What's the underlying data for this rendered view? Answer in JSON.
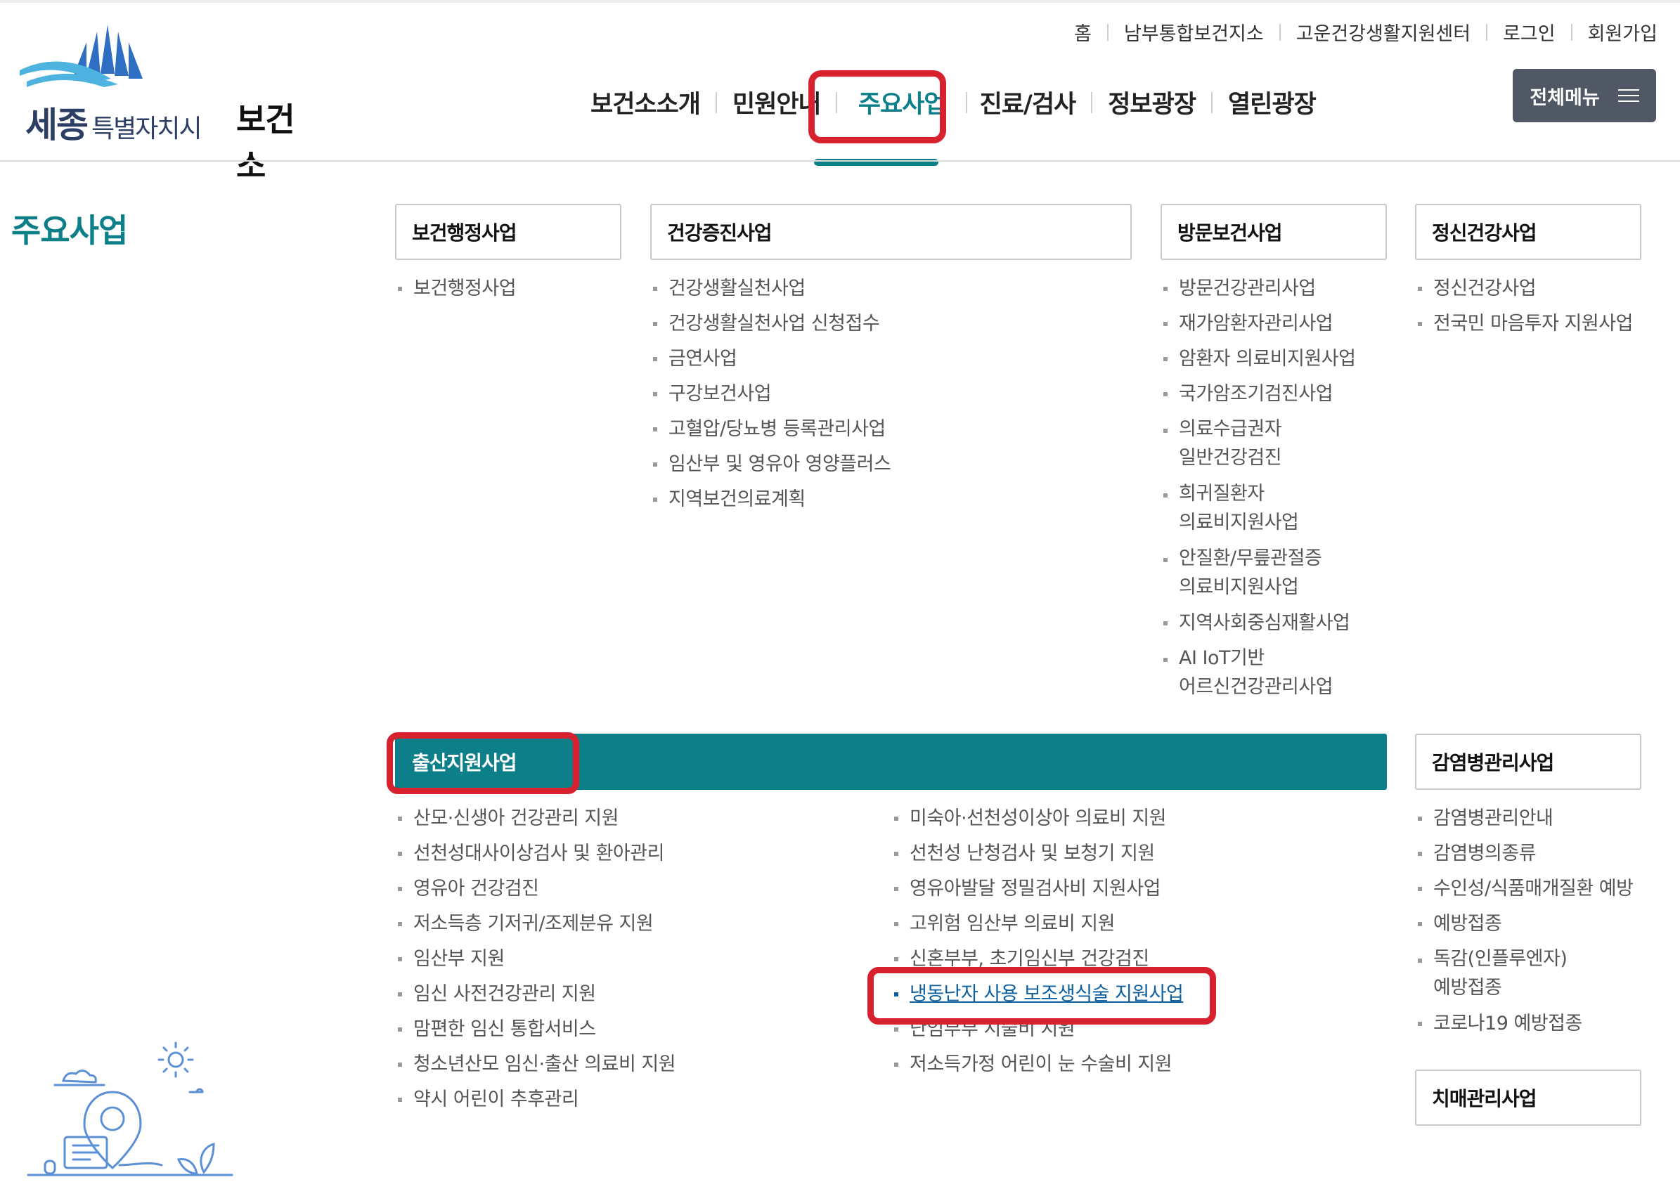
{
  "header": {
    "util_links": [
      "홈",
      "남부통합보건지소",
      "고운건강생활지원센터",
      "로그인",
      "회원가입"
    ],
    "logo": {
      "city": "세종",
      "city_sub": "특별자치시",
      "org": "보건소"
    },
    "gnb": [
      "보건소소개",
      "민원안내",
      "주요사업",
      "진료/검사",
      "정보광장",
      "열린광장"
    ],
    "active_gnb": "주요사업",
    "all_menu_label": "전체메뉴"
  },
  "side_title": "주요사업",
  "categories": {
    "admin": {
      "title": "보건행정사업",
      "items": [
        "보건행정사업"
      ]
    },
    "promo": {
      "title": "건강증진사업",
      "items": [
        "건강생활실천사업",
        "건강생활실천사업 신청접수",
        "금연사업",
        "구강보건사업",
        "고혈압/당뇨병 등록관리사업",
        "임산부 및 영유아 영양플러스",
        "지역보건의료계획"
      ]
    },
    "visit": {
      "title": "방문보건사업",
      "items": [
        "방문건강관리사업",
        "재가암환자관리사업",
        "암환자 의료비지원사업",
        "국가암조기검진사업",
        "의료수급권자",
        "일반건강검진",
        "희귀질환자",
        "의료비지원사업",
        "안질환/무릎관절증",
        "의료비지원사업",
        "지역사회중심재활사업",
        "AI IoT기반",
        "어르신건강관리사업"
      ]
    },
    "mental": {
      "title": "정신건강사업",
      "items": [
        "정신건강사업",
        "전국민 마음투자 지원사업"
      ]
    },
    "birth": {
      "title": "출산지원사업",
      "left_items": [
        "산모·신생아 건강관리 지원",
        "선천성대사이상검사 및 환아관리",
        "영유아 건강검진",
        "저소득층 기저귀/조제분유 지원",
        "임산부 지원",
        "임신 사전건강관리 지원",
        "맘편한 임신 통합서비스",
        "청소년산모 임신·출산 의료비 지원",
        "약시 어린이 추후관리"
      ],
      "right_items": [
        "미숙아·선천성이상아 의료비 지원",
        "선천성 난청검사 및 보청기 지원",
        "영유아발달 정밀검사비 지원사업",
        "고위험 임산부 의료비 지원",
        "신혼부부, 초기임신부 건강검진",
        "냉동난자 사용 보조생식술 지원사업",
        "난임부부 시술비 지원",
        "저소득가정 어린이 눈 수술비 지원"
      ]
    },
    "infect": {
      "title": "감염병관리사업",
      "items": [
        "감염병관리안내",
        "감염병의종류",
        "수인성/식품매개질환 예방",
        "예방접종",
        "독감(인플루엔자)",
        "예방접종",
        "코로나19 예방접종"
      ]
    },
    "dementia": {
      "title": "치매관리사업"
    }
  },
  "colors": {
    "accent": "#0d7f88",
    "highlight": "#d8212f",
    "link": "#0d5f9e"
  }
}
